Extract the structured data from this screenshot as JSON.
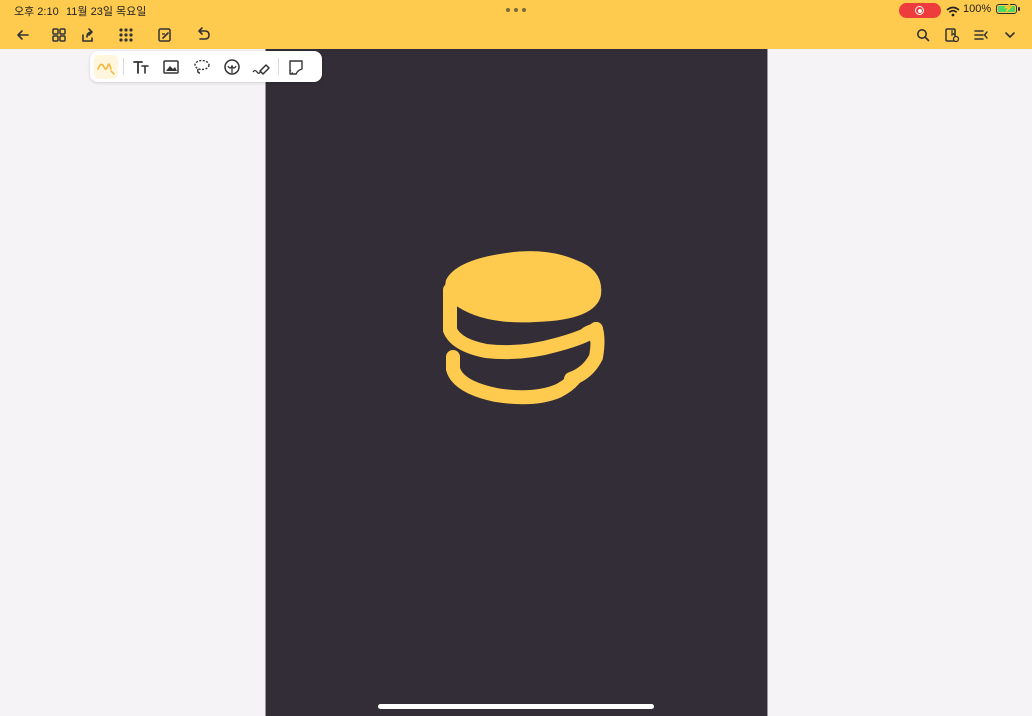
{
  "status_bar": {
    "time": "오후 2:10",
    "date": "11월 23일 목요일",
    "battery_percent": "100%",
    "battery_level": 1.0,
    "charging": true,
    "recording": true
  },
  "toolbar": {
    "left_icons": [
      "back-arrow-icon",
      "grid-view-icon",
      "share-icon",
      "apps-grid-icon",
      "edit-page-icon",
      "undo-icon"
    ],
    "right_icons": [
      "search-icon",
      "bookmark-folder-icon",
      "menu-list-icon",
      "chevron-down-icon"
    ]
  },
  "tool_palette": {
    "active_tool": "pen",
    "tools": [
      "pen",
      "text",
      "image",
      "lasso",
      "sticker",
      "eraser",
      "shape-select"
    ]
  },
  "canvas": {
    "background_color": "#322d37",
    "stroke_color": "#fecb4f",
    "app_bar_color": "#fecb4f",
    "drawing": "stacked-disc-sketch"
  }
}
